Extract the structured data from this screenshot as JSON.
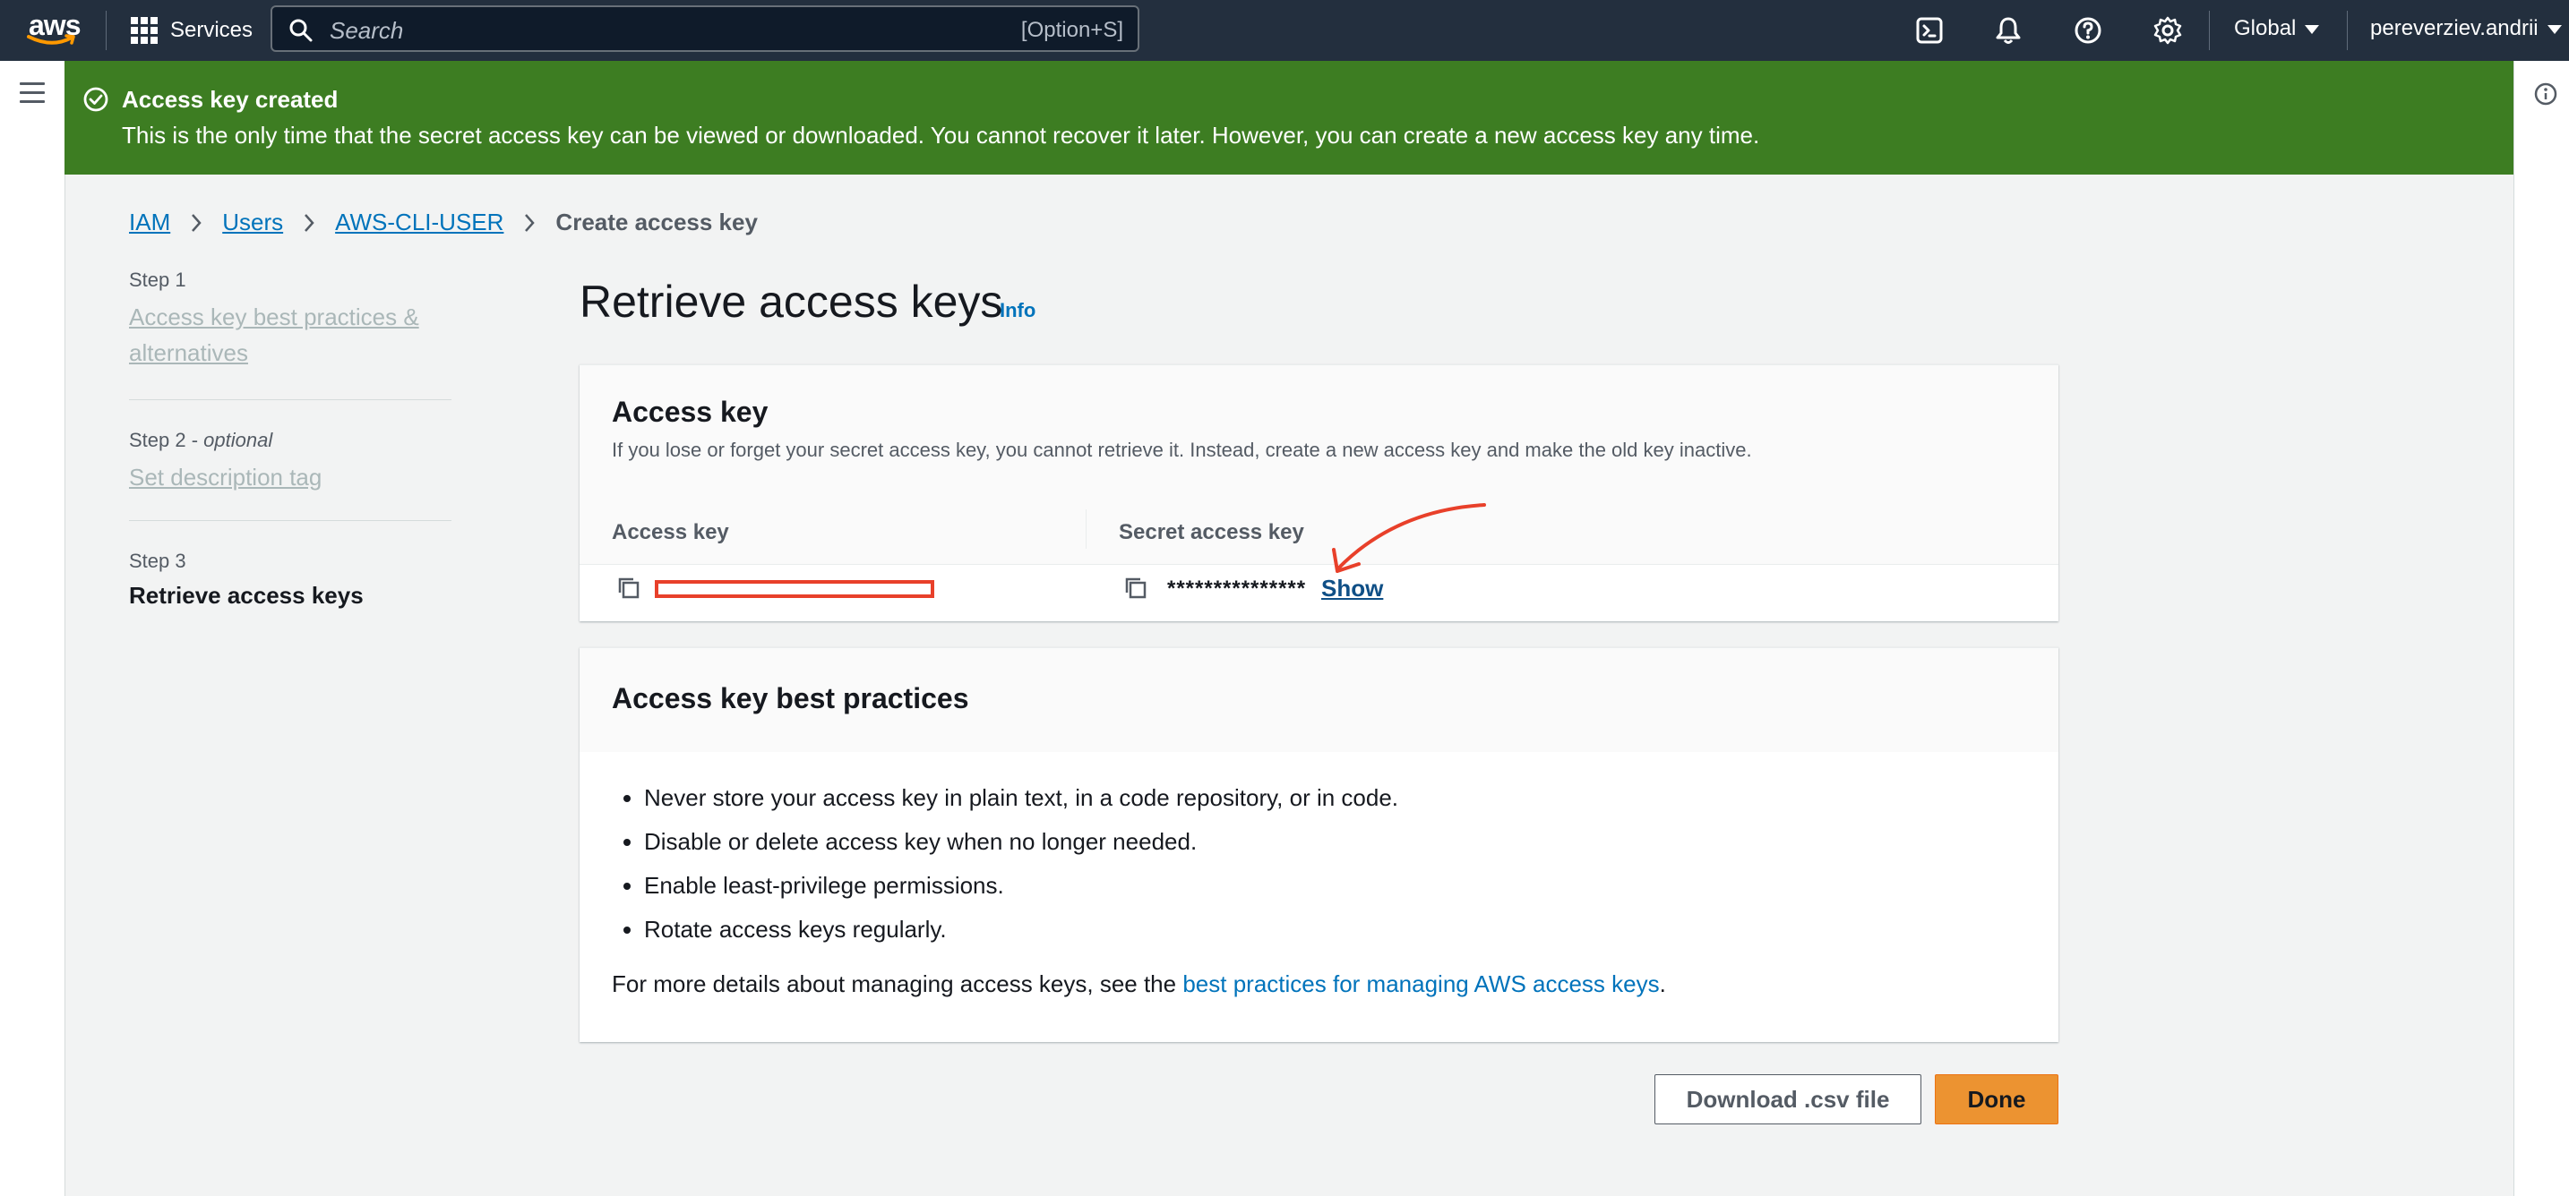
{
  "nav": {
    "logo_text": "aws",
    "services_label": "Services",
    "search_placeholder": "Search",
    "search_shortcut": "[Option+S]",
    "region": "Global",
    "user": "pereverziev.andrii",
    "icons": [
      "cloudshell-icon",
      "bell-icon",
      "help-icon",
      "settings-icon"
    ]
  },
  "flash": {
    "title": "Access key created",
    "message": "This is the only time that the secret access key can be viewed or downloaded. You cannot recover it later. However, you can create a new access key any time.",
    "color": "#3d7d22"
  },
  "breadcrumb": {
    "items": [
      "IAM",
      "Users",
      "AWS-CLI-USER"
    ],
    "current": "Create access key"
  },
  "steps": [
    {
      "label": "Step 1",
      "title": "Access key best practices & alternatives",
      "optional": ""
    },
    {
      "label": "Step 2",
      "optional": "optional",
      "title": "Set description tag"
    },
    {
      "label": "Step 3",
      "title": "Retrieve access keys",
      "optional": ""
    }
  ],
  "main": {
    "title": "Retrieve access keys",
    "info": "Info",
    "access_panel": {
      "title": "Access key",
      "description": "If you lose or forget your secret access key, you cannot retrieve it. Instead, create a new access key and make the old key inactive.",
      "col_access": "Access key",
      "col_secret": "Secret access key",
      "secret_mask": "***************",
      "show_label": "Show"
    },
    "best_practices": {
      "title": "Access key best practices",
      "items": [
        "Never store your access key in plain text, in a code repository, or in code.",
        "Disable or delete access key when no longer needed.",
        "Enable least-privilege permissions.",
        "Rotate access keys regularly."
      ],
      "more_prefix": "For more details about managing access keys, see the ",
      "more_link": "best practices for managing AWS access keys",
      "more_suffix": "."
    },
    "buttons": {
      "download": "Download .csv file",
      "done": "Done"
    }
  },
  "colors": {
    "nav_bg": "#232f3e",
    "link": "#0073bb",
    "primary": "#ec9331",
    "annotation": "#e8402a"
  }
}
